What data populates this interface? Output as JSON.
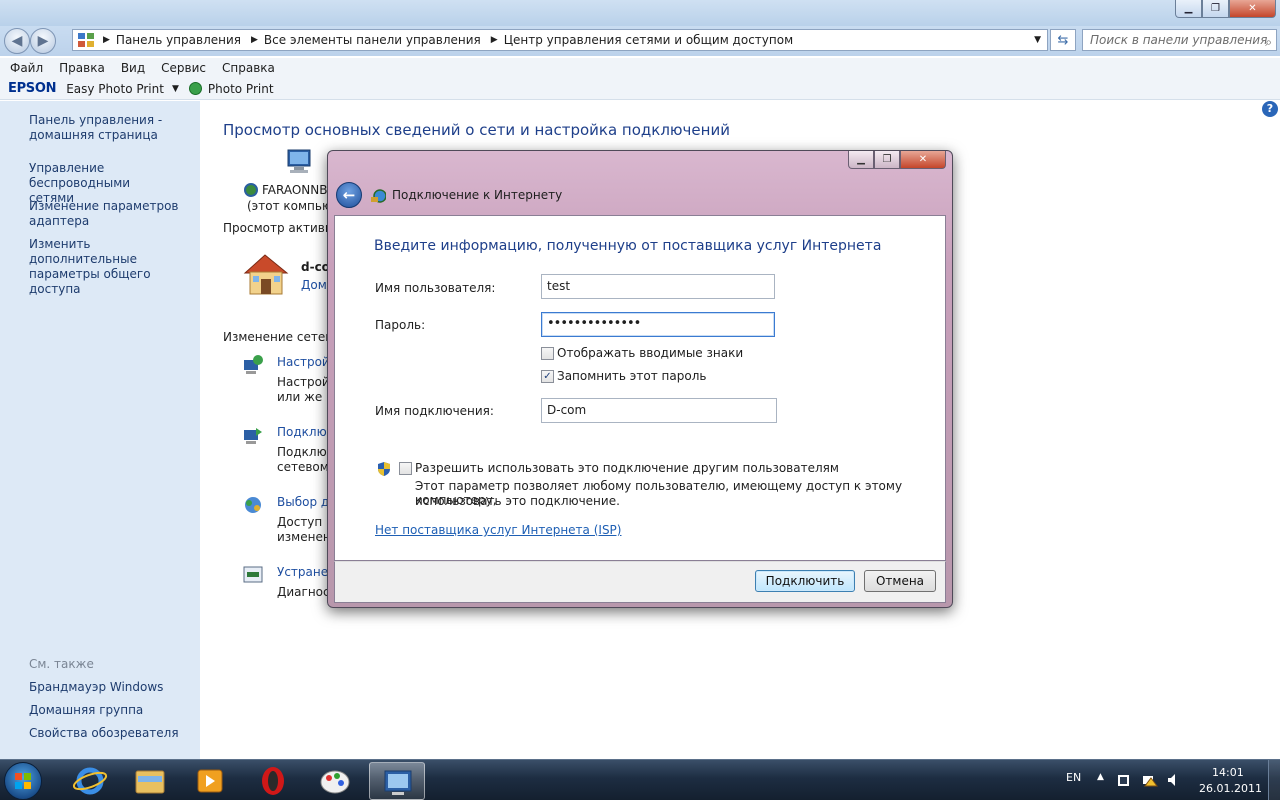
{
  "explorer": {
    "window_buttons": [
      "▁",
      "❐",
      "✕"
    ],
    "nav": {
      "back": "◀",
      "forward": "▶"
    },
    "breadcrumb": [
      "Панель управления",
      "Все элементы панели управления",
      "Центр управления сетями и общим доступом"
    ],
    "search_placeholder": "Поиск в панели управления",
    "menu": [
      "Файл",
      "Правка",
      "Вид",
      "Сервис",
      "Справка"
    ],
    "epson": {
      "logo": "EPSON",
      "easy_photo_print": "Easy Photo Print",
      "photo_print": "Photo Print"
    }
  },
  "left_pane": {
    "links": [
      {
        "l1": "Панель управления -",
        "l2": "домашняя страница"
      },
      {
        "l1": "Управление беспроводными",
        "l2": "сетями"
      },
      {
        "l1": "Изменение параметров",
        "l2": "адаптера"
      },
      {
        "l1": "Изменить дополнительные",
        "l2": "параметры общего доступа"
      }
    ],
    "see_also_title": "См. также",
    "see_also": [
      "Брандмауэр Windows",
      "Домашняя группа",
      "Свойства обозревателя"
    ]
  },
  "main": {
    "title": "Просмотр основных сведений о сети и настройка подключений",
    "computer_name": "FARAONNB",
    "computer_sub": "(этот компьют",
    "active_heading": "Просмотр активн",
    "network_name": "d-co",
    "network_type": "Дом",
    "change_heading": "Изменение сетевы",
    "tasks": [
      {
        "title": "Настрой",
        "l1": "Настрой",
        "l2": "или же н"
      },
      {
        "title": "Подключ",
        "l1": "Подключ",
        "l2": "сетевому"
      },
      {
        "title": "Выбор до",
        "l1": "Доступ к",
        "l2": "изменени"
      },
      {
        "title": "Устранен",
        "l1": "Диагност",
        "l2": ""
      }
    ]
  },
  "dialog": {
    "title": "Подключение к Интернету",
    "heading": "Введите информацию, полученную от поставщика услуг Интернета",
    "username_label": "Имя пользователя:",
    "username_value": "test",
    "password_label": "Пароль:",
    "password_value": "••••••••••••••",
    "show_chars_label": "Отображать вводимые знаки",
    "show_chars_checked": false,
    "remember_label": "Запомнить этот пароль",
    "remember_checked": true,
    "connection_name_label": "Имя подключения:",
    "connection_name_value": "D-com",
    "allow_others_label": "Разрешить использовать это подключение другим пользователям",
    "allow_others_checked": false,
    "allow_others_desc_1": "Этот параметр позволяет любому пользователю, имеющему доступ к этому компьютеру,",
    "allow_others_desc_2": "использовать это подключение.",
    "no_isp_link": "Нет поставщика услуг Интернета (ISP)",
    "connect_button": "Подключить",
    "cancel_button": "Отмена",
    "checkmark": "✓"
  },
  "taskbar": {
    "language": "EN",
    "time": "14:01",
    "date": "26.01.2011",
    "apps": [
      "internet-explorer",
      "windows-explorer",
      "media-player",
      "opera",
      "paint",
      "control-panel"
    ]
  },
  "colors": {
    "link": "#1e4ea0",
    "heading": "#1e3f8a",
    "left_pane_bg": "#dde9f6",
    "dialog_frame": "#c8a0bb"
  }
}
